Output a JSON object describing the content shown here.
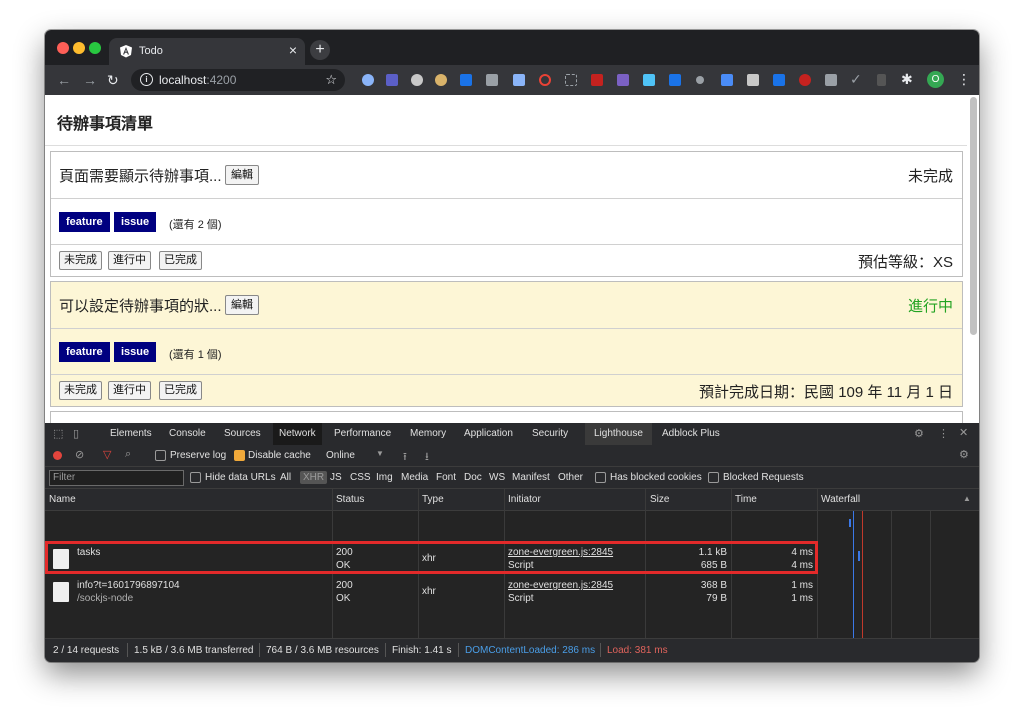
{
  "browser": {
    "tab_title": "Todo",
    "url_host": "localhost",
    "url_port": ":4200",
    "profile_initial": "O",
    "new_tab_symbol": "+",
    "close_symbol": "×"
  },
  "page": {
    "title": "待辦事項清單",
    "edit_label": "編輯",
    "status_buttons": [
      "未完成",
      "進行中",
      "已完成"
    ],
    "tasks": [
      {
        "title": "頁面需要顯示待辦事項...",
        "status": "未完成",
        "labels": [
          "feature",
          "issue"
        ],
        "remaining": "(還有 2 個)",
        "meta": "預估等級：XS"
      },
      {
        "title": "可以設定待辦事項的狀...",
        "status": "進行中",
        "labels": [
          "feature",
          "issue"
        ],
        "remaining": "(還有 1 個)",
        "meta": "預計完成日期：民國 109 年 11 月 1 日"
      }
    ]
  },
  "devtools": {
    "tabs": [
      "Elements",
      "Console",
      "Sources",
      "Network",
      "Performance",
      "Memory",
      "Application",
      "Security",
      "Lighthouse",
      "Adblock Plus"
    ],
    "active_tab": "Network",
    "toolbar": {
      "preserve_log": "Preserve log",
      "disable_cache": "Disable cache",
      "throttle": "Online"
    },
    "filter": {
      "placeholder": "Filter",
      "hide_data_urls": "Hide data URLs",
      "types": [
        "All",
        "XHR",
        "JS",
        "CSS",
        "Img",
        "Media",
        "Font",
        "Doc",
        "WS",
        "Manifest",
        "Other"
      ],
      "has_blocked_cookies": "Has blocked cookies",
      "blocked_requests": "Blocked Requests"
    },
    "columns": [
      "Name",
      "Status",
      "Type",
      "Initiator",
      "Size",
      "Time",
      "Waterfall"
    ],
    "requests": [
      {
        "name": "tasks",
        "path": "",
        "status_code": "200",
        "status_text": "OK",
        "type": "xhr",
        "initiator": "zone-evergreen.js:2845",
        "initiator_type": "Script",
        "size_transferred": "1.1 kB",
        "size_resource": "685 B",
        "time_total": "4 ms",
        "time_latency": "4 ms"
      },
      {
        "name": "info?t=1601796897104",
        "path": "/sockjs-node",
        "status_code": "200",
        "status_text": "OK",
        "type": "xhr",
        "initiator": "zone-evergreen.js:2845",
        "initiator_type": "Script",
        "size_transferred": "368 B",
        "size_resource": "79 B",
        "time_total": "1 ms",
        "time_latency": "1 ms"
      }
    ],
    "summary": {
      "requests": "2 / 14 requests",
      "transferred": "1.5 kB / 3.6 MB transferred",
      "resources": "764 B / 3.6 MB resources",
      "finish": "Finish: 1.41 s",
      "dom_content_loaded": "DOMContentLoaded: 286 ms",
      "load": "Load: 381 ms"
    }
  },
  "colors": {
    "label_bg": "#000080",
    "in_progress": "#22a322",
    "highlight": "#e32a2a",
    "card_yellow": "#fdf6d6"
  }
}
